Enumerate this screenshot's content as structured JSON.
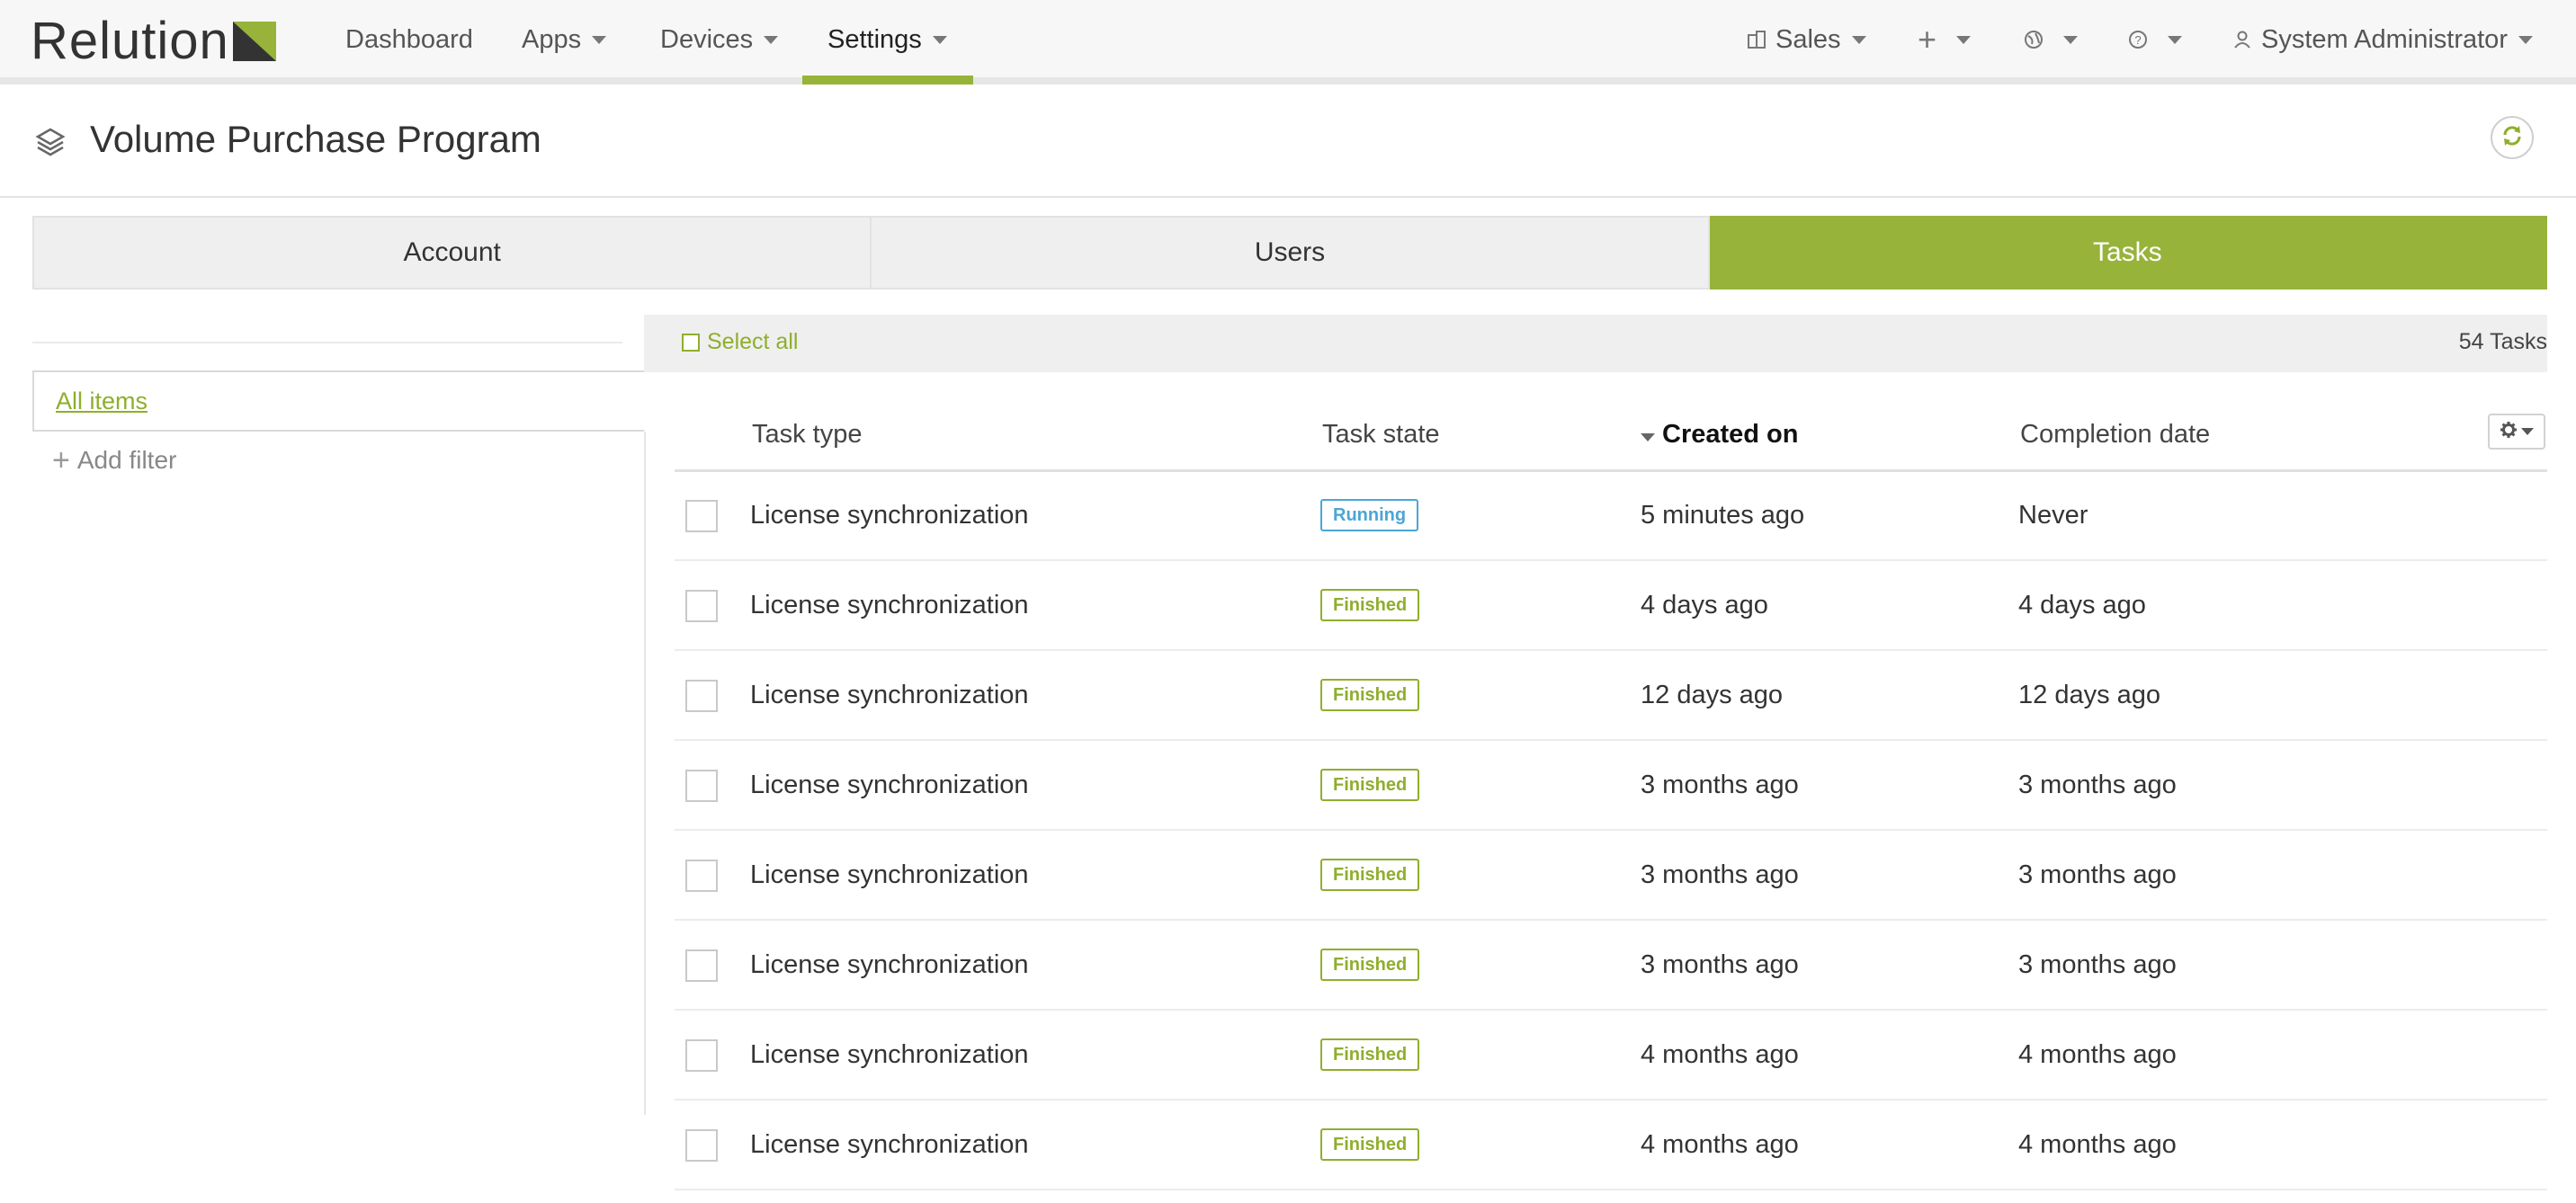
{
  "app": {
    "logo_text": "Relution",
    "brand_color": "#97b33a"
  },
  "nav": {
    "items": [
      {
        "label": "Dashboard",
        "dropdown": false
      },
      {
        "label": "Apps",
        "dropdown": true
      },
      {
        "label": "Devices",
        "dropdown": true
      },
      {
        "label": "Settings",
        "dropdown": true,
        "active": true
      }
    ],
    "right": {
      "org": {
        "label": "Sales",
        "icon": "building-icon"
      },
      "add": {
        "icon": "plus-icon"
      },
      "language": {
        "icon": "globe-icon"
      },
      "help": {
        "icon": "question-icon"
      },
      "user": {
        "label": "System Administrator",
        "icon": "user-icon"
      }
    }
  },
  "page": {
    "title": "Volume Purchase Program",
    "icon": "layers-icon",
    "refresh_icon": "refresh-icon"
  },
  "tabs": [
    {
      "label": "Account",
      "active": false
    },
    {
      "label": "Users",
      "active": false
    },
    {
      "label": "Tasks",
      "active": true
    }
  ],
  "filters": {
    "all_items": "All items",
    "add_filter": "Add filter"
  },
  "list": {
    "select_all": "Select all",
    "count": "54 Tasks",
    "columns": [
      "Task type",
      "Task state",
      "Created on",
      "Completion date"
    ],
    "sorted_column": "Created on",
    "rows": [
      {
        "type": "License synchronization",
        "state": "Running",
        "created": "5 minutes ago",
        "completed": "Never"
      },
      {
        "type": "License synchronization",
        "state": "Finished",
        "created": "4 days ago",
        "completed": "4 days ago"
      },
      {
        "type": "License synchronization",
        "state": "Finished",
        "created": "12 days ago",
        "completed": "12 days ago"
      },
      {
        "type": "License synchronization",
        "state": "Finished",
        "created": "3 months ago",
        "completed": "3 months ago"
      },
      {
        "type": "License synchronization",
        "state": "Finished",
        "created": "3 months ago",
        "completed": "3 months ago"
      },
      {
        "type": "License synchronization",
        "state": "Finished",
        "created": "3 months ago",
        "completed": "3 months ago"
      },
      {
        "type": "License synchronization",
        "state": "Finished",
        "created": "4 months ago",
        "completed": "4 months ago"
      },
      {
        "type": "License synchronization",
        "state": "Finished",
        "created": "4 months ago",
        "completed": "4 months ago"
      }
    ],
    "state_colors": {
      "Running": "#4aa6d6",
      "Finished": "#8fae2d"
    }
  }
}
